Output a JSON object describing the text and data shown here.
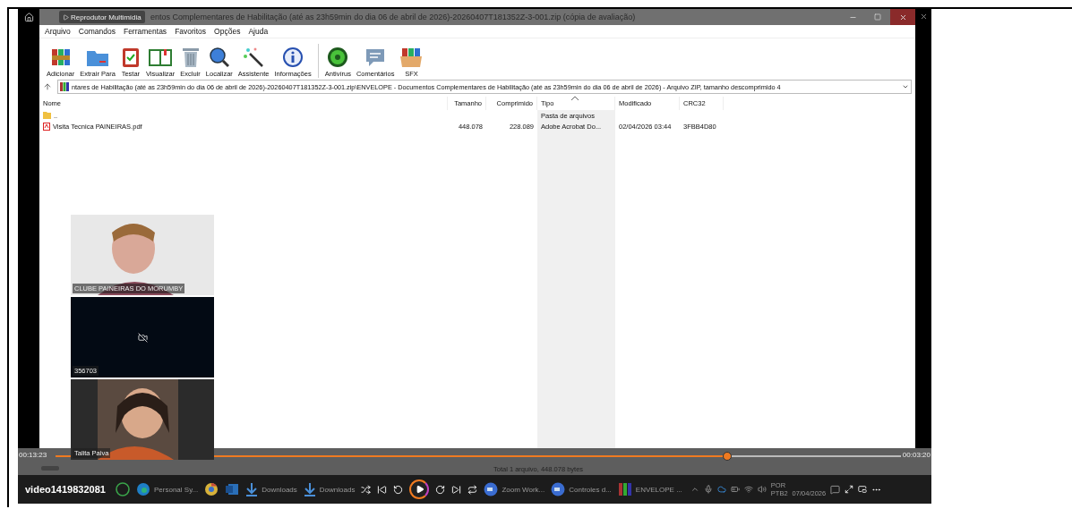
{
  "player": {
    "title": "Reprodutor Multimídia",
    "video_name": "video1419832081",
    "elapsed": "00:13:23",
    "duration": "00:03:20",
    "level": 0.795
  },
  "window": {
    "title": "entos Complementares de Habilitação (até as 23h59min do dia 06 de abril de 2026)-20260407T181352Z-3-001.zip (cópia de avaliação)"
  },
  "menu": [
    "Arquivo",
    "Comandos",
    "Ferramentas",
    "Favoritos",
    "Opções",
    "Ajuda"
  ],
  "toolbar_groups": [
    {
      "buttons": [
        "Adicionar",
        "Extrair Para",
        "Testar",
        "Visualizar",
        "Excluir",
        "Localizar",
        "Assistente",
        "Informações"
      ]
    },
    {
      "buttons": [
        "Antivírus",
        "Comentários",
        "SFX"
      ]
    }
  ],
  "path": "ntares de Habilitação (até as 23h59min do dia 06 de abril de 2026)-20260407T181352Z-3-001.zip\\ENVELOPE - Documentos Complementares de Habilitação (até as 23h59min do dia 06 de abril de 2026) - Arquivo ZIP, tamanho descomprimido 4",
  "columns": [
    {
      "label": "Nome",
      "sorted": false
    },
    {
      "label": "Tamanho",
      "sorted": false
    },
    {
      "label": "Comprimido",
      "sorted": false
    },
    {
      "label": "Tipo",
      "sorted": true
    },
    {
      "label": "Modificado",
      "sorted": false
    },
    {
      "label": "CRC32",
      "sorted": false
    }
  ],
  "rows": [
    {
      "kind": "folder",
      "name": "..",
      "size": "",
      "packed": "",
      "type": "Pasta de arquivos",
      "modified": "",
      "crc": ""
    },
    {
      "kind": "pdf",
      "name": "Visita Tecnica PAINEIRAS.pdf",
      "size": "448.078",
      "packed": "228.089",
      "type": "Adobe Acrobat Do...",
      "modified": "02/04/2026 03:44",
      "crc": "3FBB4D80"
    }
  ],
  "status": "Total 1 arquivo, 448.078 bytes",
  "tiles": [
    {
      "kind": "picture",
      "label": "CLUBE PAINEIRAS DO MORUMBY"
    },
    {
      "kind": "camera_off",
      "label": "356703"
    },
    {
      "kind": "picture",
      "label": "Talita Paiva"
    }
  ],
  "taskbar": {
    "items": [
      {
        "kind": "whatsapp"
      },
      {
        "kind": "edge",
        "label": "Personal Sy..."
      },
      {
        "kind": "chrome"
      },
      {
        "kind": "outlook"
      },
      {
        "kind": "download",
        "label": "Downloads"
      },
      {
        "kind": "download",
        "label": "Downloads"
      },
      {
        "kind": "gap"
      },
      {
        "kind": "zoom",
        "label": "Zoom Work..."
      },
      {
        "kind": "zoom",
        "label": "Controles d..."
      },
      {
        "kind": "winrar",
        "label": "ENVELOPE ..."
      }
    ],
    "language": [
      "POR",
      "PTB2"
    ],
    "date": "07/04/2026"
  }
}
